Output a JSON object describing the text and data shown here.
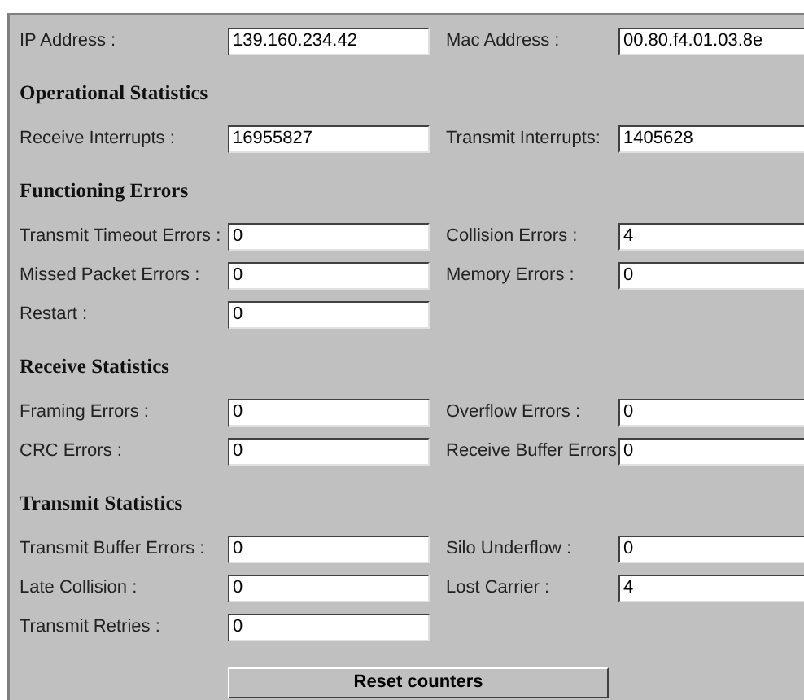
{
  "address_row": [
    {
      "label": "IP Address :",
      "value": "139.160.234.42"
    },
    {
      "label": "Mac Address :",
      "value": "00.80.f4.01.03.8e"
    }
  ],
  "sections": [
    {
      "title": "Operational Statistics",
      "rows": [
        [
          {
            "label": "Receive Interrupts :",
            "value": "16955827"
          },
          {
            "label": "Transmit Interrupts:",
            "value": "1405628"
          }
        ]
      ]
    },
    {
      "title": "Functioning Errors",
      "rows": [
        [
          {
            "label": "Transmit Timeout Errors :",
            "value": "0"
          },
          {
            "label": "Collision Errors :",
            "value": "4"
          }
        ],
        [
          {
            "label": "Missed Packet Errors :",
            "value": "0"
          },
          {
            "label": "Memory Errors :",
            "value": "0"
          }
        ],
        [
          {
            "label": "Restart :",
            "value": "0"
          }
        ]
      ]
    },
    {
      "title": "Receive Statistics",
      "rows": [
        [
          {
            "label": "Framing Errors :",
            "value": "0"
          },
          {
            "label": "Overflow Errors :",
            "value": "0"
          }
        ],
        [
          {
            "label": "CRC Errors :",
            "value": "0"
          },
          {
            "label": "Receive Buffer Errors:",
            "value": "0"
          }
        ]
      ]
    },
    {
      "title": "Transmit Statistics",
      "rows": [
        [
          {
            "label": "Transmit Buffer Errors :",
            "value": "0"
          },
          {
            "label": "Silo Underflow :",
            "value": "0"
          }
        ],
        [
          {
            "label": "Late Collision :",
            "value": "0"
          },
          {
            "label": "Lost Carrier :",
            "value": "4"
          }
        ],
        [
          {
            "label": "Transmit Retries :",
            "value": "0"
          }
        ]
      ]
    }
  ],
  "reset_button": "Reset counters"
}
